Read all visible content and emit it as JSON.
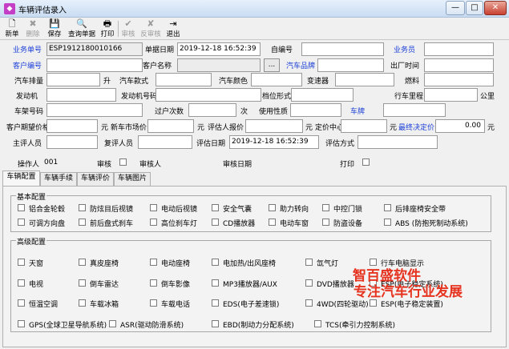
{
  "window": {
    "title": "车辆评估录入",
    "minimize": "—",
    "maximize": "□",
    "close": "✕"
  },
  "toolbar": [
    {
      "label": "新单",
      "icon": "new-doc-icon",
      "glyph": "🗋",
      "enabled": true
    },
    {
      "label": "删除",
      "icon": "delete-icon",
      "glyph": "✖",
      "enabled": false
    },
    {
      "label": "保存",
      "icon": "save-icon",
      "glyph": "💾",
      "enabled": true
    },
    {
      "label": "查询单据",
      "icon": "search-doc-icon",
      "glyph": "🔍",
      "enabled": true
    },
    {
      "label": "打印",
      "icon": "printer-icon",
      "glyph": "🖶",
      "enabled": true
    },
    {
      "label": "审核",
      "icon": "approve-icon",
      "glyph": "✔",
      "enabled": false
    },
    {
      "label": "反审核",
      "icon": "unapprove-icon",
      "glyph": "✘",
      "enabled": false
    },
    {
      "label": "退出",
      "icon": "exit-icon",
      "glyph": "⇥",
      "enabled": true
    }
  ],
  "form": {
    "order_no_label": "业务单号",
    "order_no": "ESP1912180010166",
    "order_date_label": "单据日期",
    "order_date": "2019-12-18 16:52:39",
    "self_no_label": "自编号",
    "self_no": "",
    "salesman_label": "业务员",
    "salesman": "",
    "customer_no_label": "客户编号",
    "customer_no": "",
    "customer_name_label": "客户名称",
    "customer_name": "",
    "browse_btn": "...",
    "brand_label": "汽车品牌",
    "brand": "",
    "factory_date_label": "出厂时间",
    "factory_date": "",
    "displacement_label": "汽车排量",
    "displacement": "",
    "displacement_unit": "升",
    "model_label": "汽车款式",
    "model": "",
    "color_label": "汽车颜色",
    "color": "",
    "gearbox_label": "变速器",
    "gearbox": "",
    "fuel_label": "燃料",
    "fuel": "",
    "engine_label": "发动机",
    "engine": "",
    "engine_no_label": "发动机号码",
    "engine_no": "",
    "gear_type_label": "档位形式",
    "gear_type": "",
    "mileage_label": "行车里程",
    "mileage": "",
    "mileage_unit": "公里",
    "frame_no_label": "车架号码",
    "frame_no": "",
    "transfer_label": "过户次数",
    "transfer": "",
    "transfer_unit": "次",
    "usage_label": "使用性质",
    "usage": "",
    "plate_label": "车牌",
    "plate": "",
    "expect_price_label": "客户期望价格",
    "expect_price": "",
    "yuan1": "元",
    "new_price_label": "新车市场价",
    "new_price": "",
    "yuan2": "元",
    "assessor_quote_label": "评估人报价",
    "assessor_quote": "",
    "yuan3": "元",
    "price_center_label": "定价中心",
    "price_center": "",
    "yuan4": "元",
    "final_price_label": "最终决定价",
    "final_price": "0.00",
    "yuan5": "元",
    "main_assessor_label": "主评人员",
    "main_assessor": "",
    "review_assessor_label": "复评人员",
    "review_assessor": "",
    "assess_date_label": "评估日期",
    "assess_date": "2019-12-18 16:52:39",
    "assess_method_label": "评估方式",
    "assess_method": "",
    "operator_label": "操作人",
    "operator": "001",
    "audit_label": "审核",
    "auditor_label": "审核人",
    "audit_date_label": "审核日期",
    "print_label": "打印"
  },
  "tabs": [
    "车辆配置",
    "车辆手续",
    "车辆评价",
    "车辆图片"
  ],
  "basic": {
    "title": "基本配置",
    "options": [
      "铝合金轮毂",
      "防炫目后视镜",
      "电动后视镜",
      "安全气囊",
      "助力转向",
      "中控门锁",
      "后排座椅安全带",
      "可调方向盘",
      "前后盘式刹车",
      "高位刹车灯",
      "CD播放器",
      "电动车窗",
      "防盗设备",
      "ABS (防抱死制动系统)"
    ]
  },
  "advanced": {
    "title": "高级配置",
    "options": [
      "天窗",
      "真皮座椅",
      "电动座椅",
      "电加热/出风座椅",
      "氙气灯",
      "行车电脑显示",
      "电视",
      "倒车雷达",
      "倒车影像",
      "MP3播放器/AUX",
      "DVD播放器",
      "ESP(电子稳定系统)",
      "恒温空调",
      "车载冰箱",
      "车载电话",
      "EDS(电子差速锁)",
      "4WD(四轮驱动)",
      "ESP(电子稳定装置)",
      "GPS(全球卫星导航系统)",
      "ASR(驱动防滑系统)",
      "EBD(制动力分配系统)",
      "TCS(牵引力控制系统)"
    ]
  },
  "watermark": {
    "line1": "智百盛软件",
    "line2": "专注汽车行业发展"
  },
  "colors": {
    "blue_label": "#1b3fd8",
    "watermark": "#e6331f"
  }
}
